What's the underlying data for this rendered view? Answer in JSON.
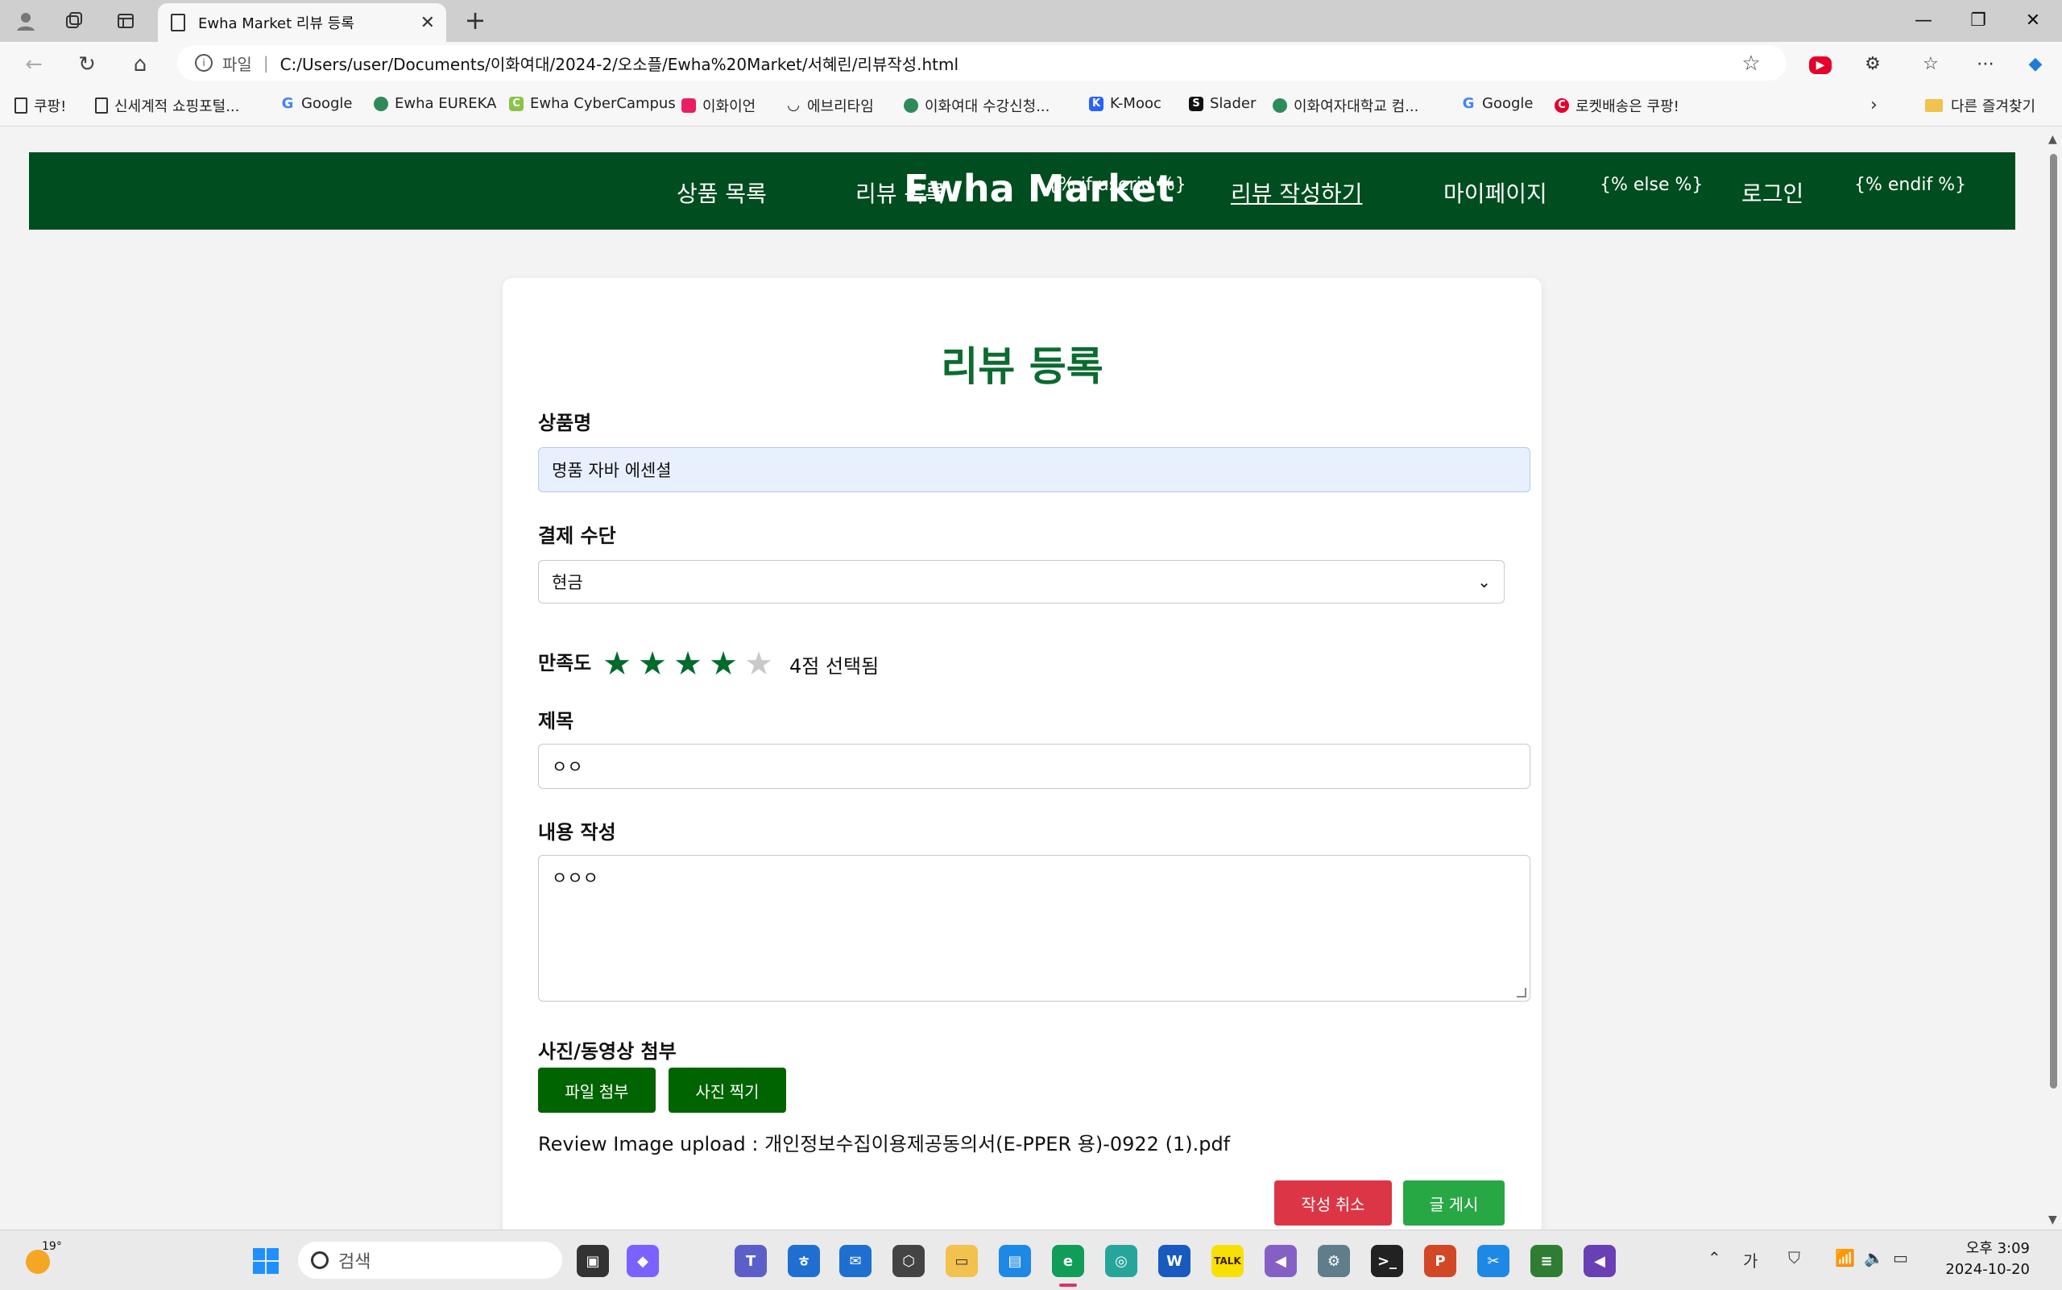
{
  "browser": {
    "tab_title": "Ewha Market 리뷰 등록",
    "address_scheme": "파일",
    "address_url": "C:/Users/user/Documents/이화여대/2024-2/오소플/Ewha%20Market/서혜린/리뷰작성.html",
    "bookmarks": [
      {
        "label": "쿠팡!",
        "icon": "page-icon"
      },
      {
        "label": "신세계적 쇼핑포털...",
        "icon": "page-icon"
      },
      {
        "label": "Google",
        "icon": "google-icon"
      },
      {
        "label": "Ewha EUREKA",
        "icon": "ewha-icon"
      },
      {
        "label": "Ewha CyberCampus",
        "icon": "cybercampus-icon"
      },
      {
        "label": "이화이언",
        "icon": "ewhaian-icon"
      },
      {
        "label": "에브리타임",
        "icon": "everytime-icon"
      },
      {
        "label": "이화여대 수강신청...",
        "icon": "ewha-icon"
      },
      {
        "label": "K-Mooc",
        "icon": "kmooc-icon"
      },
      {
        "label": "Slader",
        "icon": "slader-icon"
      },
      {
        "label": "이화여자대학교 컴...",
        "icon": "ewha-icon"
      },
      {
        "label": "Google",
        "icon": "google-icon"
      },
      {
        "label": "로켓배송은 쿠팡!",
        "icon": "coupang-icon"
      }
    ],
    "other_bookmarks": "다른 즐겨찾기"
  },
  "site": {
    "brand": "Ewha Market",
    "nav": {
      "products": "상품 목록",
      "reviews": "리뷰 목록",
      "tpl_if": "{% if userid %}",
      "write_review": "리뷰 작성하기",
      "mypage": "마이페이지",
      "tpl_else": "{% else %}",
      "login": "로그인",
      "tpl_endif": "{% endif %}"
    }
  },
  "form": {
    "heading": "리뷰 등록",
    "product_label": "상품명",
    "product_value": "명품 자바 에센셜",
    "payment_label": "결제 수단",
    "payment_value": "현금",
    "rating_label": "만족도",
    "rating": 4,
    "rating_max": 5,
    "rating_text": "4점 선택됨",
    "title_label": "제목",
    "title_value": "ㅇㅇ",
    "content_label": "내용 작성",
    "content_value": "ㅇㅇㅇ",
    "attach_label": "사진/동영상 첨부",
    "attach_file_button": "파일 첨부",
    "take_photo_button": "사진 찍기",
    "upload_text": "Review Image upload : 개인정보수집이용제공동의서(E-PPER 용)-0922 (1).pdf",
    "cancel_button": "작성 취소",
    "submit_button": "글 게시"
  },
  "taskbar": {
    "weather_temp": "19°",
    "search_placeholder": "검색",
    "ime": "가",
    "time": "오후 3:09",
    "date": "2024-10-20"
  },
  "colors": {
    "header_bg": "#004d1f",
    "heading": "#0b6b30",
    "star_on": "#006b2a",
    "cancel": "#dc3545",
    "submit": "#28a745"
  }
}
